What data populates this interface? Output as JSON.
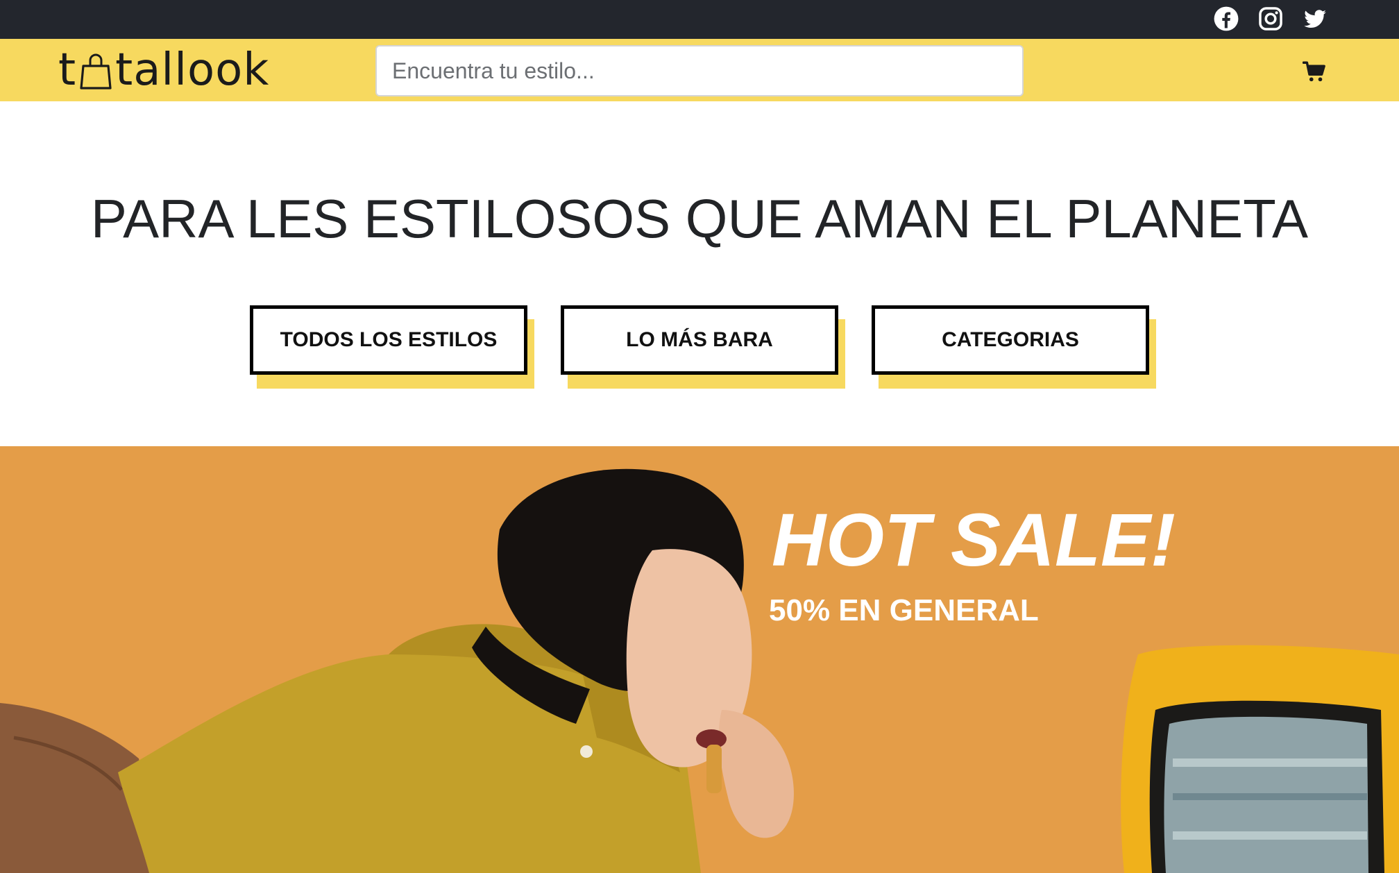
{
  "social": {
    "items": [
      {
        "name": "facebook",
        "icon": "facebook-icon"
      },
      {
        "name": "instagram",
        "icon": "instagram-icon"
      },
      {
        "name": "twitter",
        "icon": "twitter-icon"
      }
    ]
  },
  "header": {
    "logo_prefix": "t",
    "logo_icon": "shopping-bag-icon",
    "logo_suffix": "tallook",
    "search_placeholder": "Encuentra tu estilo...",
    "cart_icon": "cart-icon"
  },
  "hero_intro": {
    "headline": "PARA LES ESTILOSOS QUE AMAN EL PLANETA",
    "buttons": [
      "TODOS LOS ESTILOS",
      "LO MÁS BARA",
      "CATEGORIAS"
    ]
  },
  "banner": {
    "title": "HOT SALE!",
    "subtitle": "50% EN GENERAL"
  },
  "colors": {
    "topbar": "#23262d",
    "brand_yellow": "#f7d95f",
    "banner_orange": "#e49d48",
    "text_dark": "#222427"
  }
}
